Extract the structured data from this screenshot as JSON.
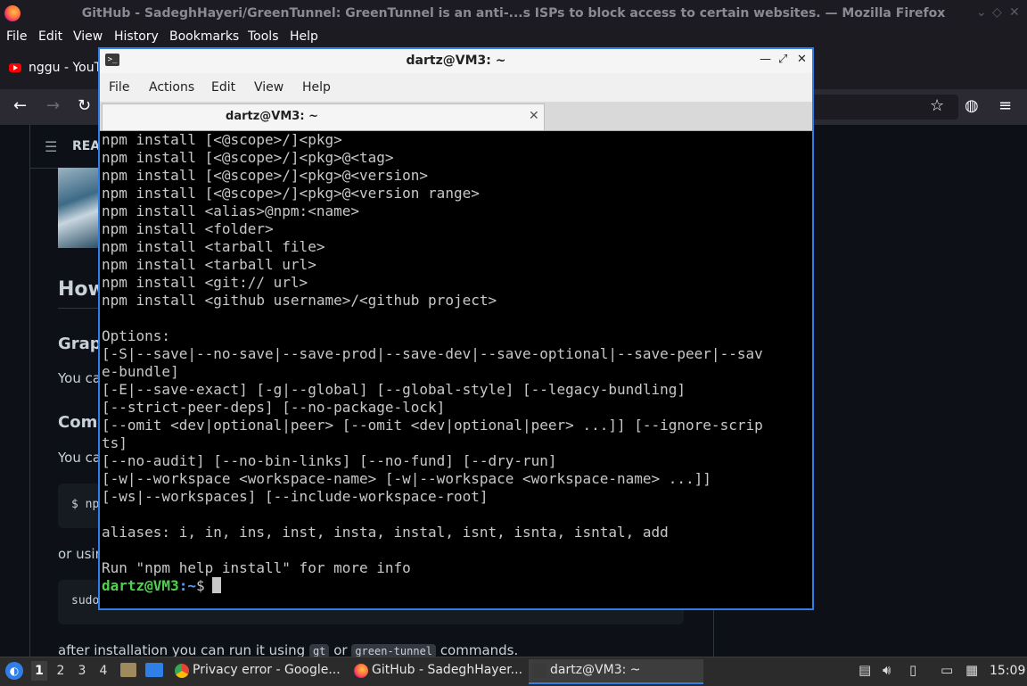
{
  "firefox": {
    "window_title": "GitHub - SadeghHayeri/GreenTunnel: GreenTunnel is an anti-...s ISPs to block access to certain websites. — Mozilla Firefox",
    "menus": [
      "File",
      "Edit",
      "View",
      "History",
      "Bookmarks",
      "Tools",
      "Help"
    ],
    "tab_label": "nggu - YouTu",
    "readme_label": "REA",
    "content": {
      "heading_how": "How",
      "heading_graph": "Grap",
      "text_you1": "You ca",
      "heading_com": "Com",
      "text_you2": "You ca",
      "code1": "$ np",
      "text_or": "or usin",
      "code2": "sudo",
      "after_install_pre": "after installation you can run it using",
      "code_gt": "gt",
      "after_install_or": "or",
      "code_green": "green-tunnel",
      "after_install_post": "commands."
    }
  },
  "terminal": {
    "window_title": "dartz@VM3: ~",
    "menus": [
      "File",
      "Actions",
      "Edit",
      "View",
      "Help"
    ],
    "tab_label": "dartz@VM3: ~",
    "output_lines": [
      "npm install [<@scope>/]<pkg>",
      "npm install [<@scope>/]<pkg>@<tag>",
      "npm install [<@scope>/]<pkg>@<version>",
      "npm install [<@scope>/]<pkg>@<version range>",
      "npm install <alias>@npm:<name>",
      "npm install <folder>",
      "npm install <tarball file>",
      "npm install <tarball url>",
      "npm install <git:// url>",
      "npm install <github username>/<github project>",
      "",
      "Options:",
      "[-S|--save|--no-save|--save-prod|--save-dev|--save-optional|--save-peer|--sav",
      "e-bundle]",
      "[-E|--save-exact] [-g|--global] [--global-style] [--legacy-bundling]",
      "[--strict-peer-deps] [--no-package-lock]",
      "[--omit <dev|optional|peer> [--omit <dev|optional|peer> ...]] [--ignore-scrip",
      "ts]",
      "[--no-audit] [--no-bin-links] [--no-fund] [--dry-run]",
      "[-w|--workspace <workspace-name> [-w|--workspace <workspace-name> ...]]",
      "[-ws|--workspaces] [--include-workspace-root]",
      "",
      "aliases: i, in, ins, inst, insta, instal, isnt, isnta, isntal, add",
      "",
      "Run \"npm help install\" for more info"
    ],
    "prompt": {
      "user_host": "dartz@VM3",
      "path": ":~",
      "symbol": "$"
    }
  },
  "taskbar": {
    "workspaces": [
      "1",
      "2",
      "3",
      "4"
    ],
    "tasks": [
      {
        "label": "Privacy error - Google..."
      },
      {
        "label": "GitHub - SadeghHayer..."
      },
      {
        "label": "dartz@VM3: ~"
      }
    ],
    "clock": "15:09"
  },
  "colors": {
    "accent": "#2f7fe6",
    "prompt_user": "#4fd14f",
    "prompt_path": "#5c9cff"
  }
}
